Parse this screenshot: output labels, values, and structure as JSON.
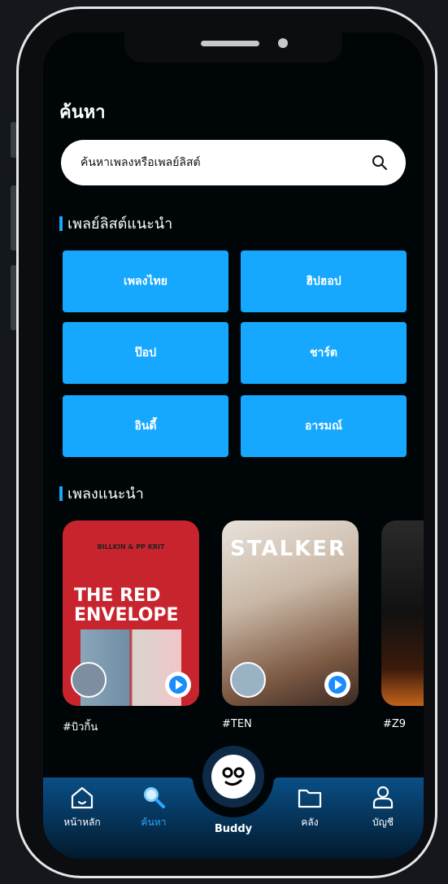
{
  "header": {
    "title": "ค้นหา"
  },
  "search": {
    "placeholder": "ค้นหาเพลงหรือเพลย์ลิสต์"
  },
  "playlists": {
    "title": "เพลย์ลิสต์แนะนำ",
    "genres": [
      "เพลงไทย",
      "ฮิปฮอป",
      "ป๊อป",
      "ชาร์ต",
      "อินดี้",
      "อารมณ์"
    ]
  },
  "recommended": {
    "title": "เพลงแนะนำ",
    "cards": [
      {
        "label": "#บิวกิ้น",
        "cover_text_top": "BILLKIN & PP KRIT",
        "cover_text_1": "THE RED",
        "cover_text_2": "ENVELOPE"
      },
      {
        "label": "#TEN",
        "cover_text_top": "STALKER"
      },
      {
        "label": "#Z9"
      }
    ]
  },
  "nav": {
    "home": "หน้าหลัก",
    "search": "ค้นหา",
    "buddy": "Buddy",
    "library": "คลัง",
    "account": "บัญชี"
  },
  "colors": {
    "accent": "#16a8ff",
    "background": "#000508",
    "nav_active": "#2ea8ff"
  }
}
